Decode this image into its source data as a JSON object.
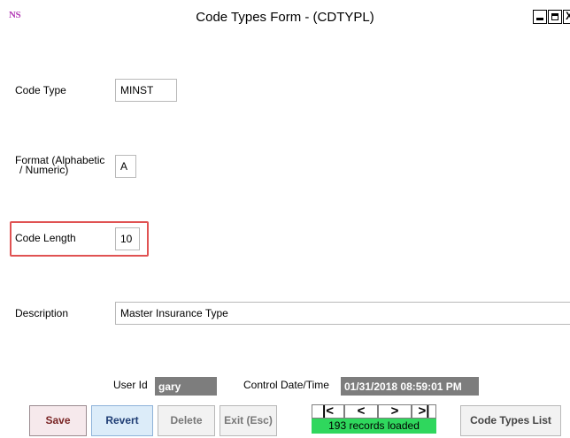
{
  "window": {
    "logo": "NS",
    "title": "Code Types Form - (CDTYPL)",
    "close_glyph": "X"
  },
  "form": {
    "code_type": {
      "label": "Code Type",
      "value": "MINST"
    },
    "format": {
      "label_line1": "Format (Alphabetic",
      "label_line2": "/ Numeric)",
      "value": "A"
    },
    "code_length": {
      "label": "Code Length",
      "value": "10"
    },
    "description": {
      "label": "Description",
      "value": "Master Insurance Type"
    },
    "user_id": {
      "label": "User Id",
      "value": "gary"
    },
    "control_datetime": {
      "label": "Control Date/Time",
      "value": "01/31/2018 08:59:01 PM"
    }
  },
  "buttons": {
    "save": "Save",
    "revert": "Revert",
    "delete": "Delete",
    "exit": "Exit (Esc)",
    "code_types_list": "Code Types List"
  },
  "navigation": {
    "first": "|<",
    "prev": "<",
    "next": ">",
    "last": ">|",
    "records_status": "193 records loaded"
  },
  "colors": {
    "highlight_border": "#e05252",
    "records_status_bg": "#2fd75d",
    "readonly_bg": "#7d7d7d"
  }
}
